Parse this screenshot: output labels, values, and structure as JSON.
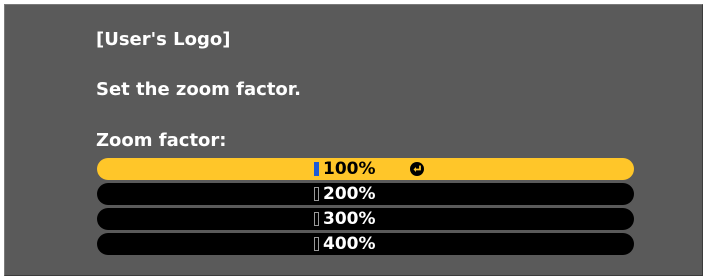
{
  "dialog": {
    "title": "[User's Logo]",
    "instruction": "Set the zoom factor.",
    "field_label": "Zoom factor:",
    "options": [
      {
        "label": "100%",
        "selected": true
      },
      {
        "label": "200%",
        "selected": false
      },
      {
        "label": "300%",
        "selected": false
      },
      {
        "label": "400%",
        "selected": false
      }
    ],
    "selected_option_icon": "enter-icon"
  },
  "colors": {
    "panel_background": "#5a5a5a",
    "selected_highlight": "#ffc629",
    "option_background": "#000000",
    "radio_selected": "#1e5bd6",
    "text_primary": "#ffffff"
  }
}
